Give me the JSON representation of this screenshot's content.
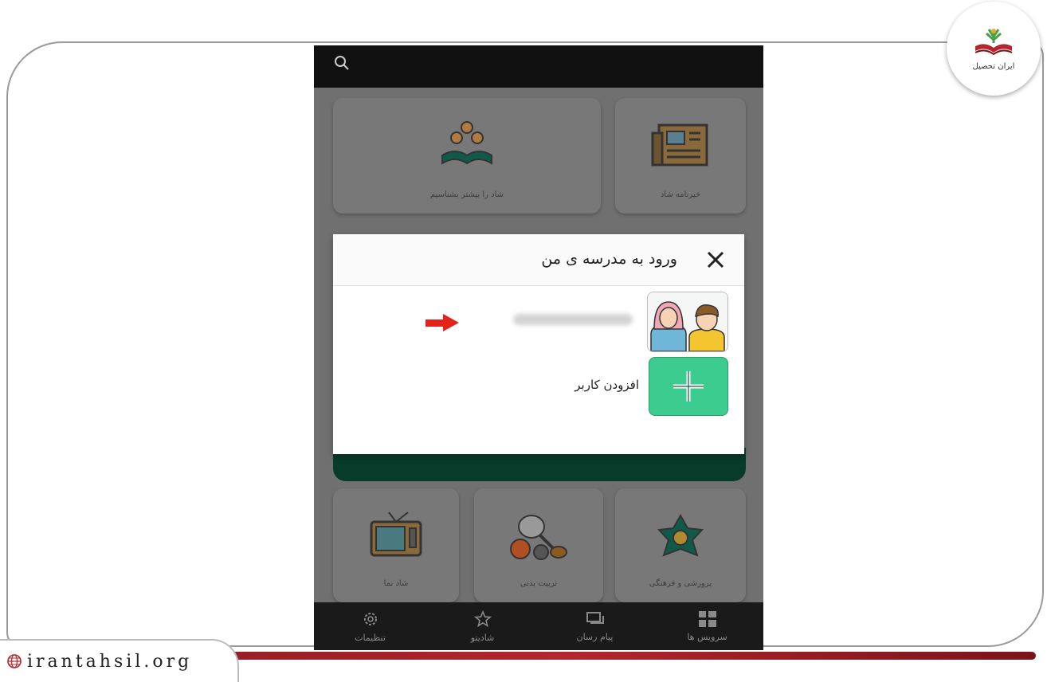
{
  "website": {
    "url": "irantahsil.org",
    "logo_text": "ایران تحصیل"
  },
  "app": {
    "tiles_top": [
      {
        "label": "خبرنامه شاد",
        "icon": "newspaper-icon"
      },
      {
        "label": "شاد را بیشتر بشناسیم",
        "icon": "people-icon"
      }
    ],
    "tiles_bottom": [
      {
        "label": "پرورشی و فرهنگی",
        "icon": "star-ornament-icon"
      },
      {
        "label": "تربیت بدنی",
        "icon": "sports-balls-icon"
      },
      {
        "label": "شاد نما",
        "icon": "tv-icon"
      }
    ],
    "bottom_nav": [
      {
        "label": "سرویس ها",
        "icon": "grid-icon"
      },
      {
        "label": "پیام رسان",
        "icon": "chat-icon"
      },
      {
        "label": "شادیتو",
        "icon": "star-icon"
      },
      {
        "label": "تنظیمات",
        "icon": "gear-icon"
      }
    ]
  },
  "modal": {
    "title": "ورود به مدرسه ی من",
    "add_user_label": "افزودن کاربر",
    "accent_color": "#3ccc8f"
  },
  "colors": {
    "arrow": "#e3241b",
    "dark_green": "#083c2a",
    "brand_red": "#b3262e"
  }
}
